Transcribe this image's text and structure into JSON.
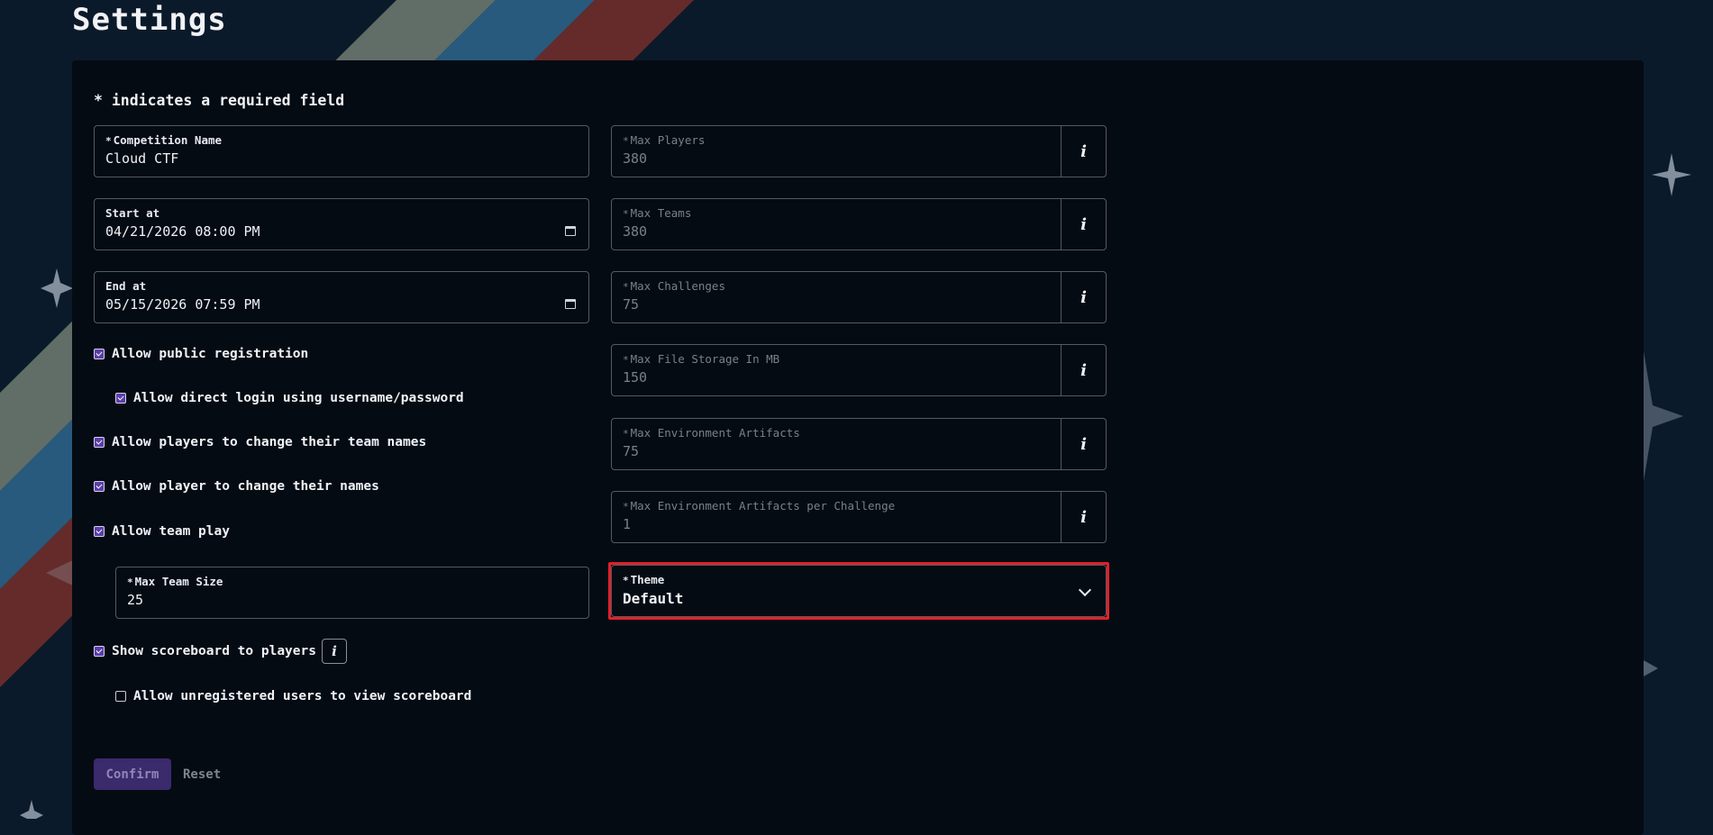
{
  "page": {
    "title": "Settings"
  },
  "form": {
    "required_note": "* indicates a required field",
    "required_marker": "*",
    "competition_name": {
      "label": "Competition Name",
      "value": "Cloud CTF",
      "required": true
    },
    "start_at": {
      "label": "Start at",
      "value": "04/21/2026 08:00 PM"
    },
    "end_at": {
      "label": "End at",
      "value": "05/15/2026 07:59 PM"
    },
    "checkboxes": {
      "public_registration": {
        "label": "Allow public registration",
        "checked": true
      },
      "direct_login": {
        "label": "Allow direct login using username/password",
        "checked": true
      },
      "change_team_names": {
        "label": "Allow players to change their team names",
        "checked": true
      },
      "change_names": {
        "label": "Allow player to change their names",
        "checked": true
      },
      "team_play": {
        "label": "Allow team play",
        "checked": true
      },
      "show_scoreboard": {
        "label": "Show scoreboard to players",
        "checked": true
      },
      "unregistered_scoreboard": {
        "label": "Allow unregistered users to view scoreboard",
        "checked": false
      }
    },
    "max_team_size": {
      "label": "Max Team Size",
      "value": "25",
      "required": true
    },
    "limits": [
      {
        "label": "Max Players",
        "value": "380",
        "required": true,
        "info": "i"
      },
      {
        "label": "Max Teams",
        "value": "380",
        "required": true,
        "info": "i"
      },
      {
        "label": "Max Challenges",
        "value": "75",
        "required": true,
        "info": "i"
      },
      {
        "label": "Max File Storage In MB",
        "value": "150",
        "required": true,
        "info": "i"
      },
      {
        "label": "Max Environment Artifacts",
        "value": "75",
        "required": true,
        "info": "i"
      },
      {
        "label": "Max Environment Artifacts per Challenge",
        "value": "1",
        "required": true,
        "info": "i"
      }
    ],
    "theme": {
      "label": "Theme",
      "value": "Default",
      "required": true,
      "focused": true
    },
    "info_glyph": "i",
    "buttons": {
      "confirm": "Confirm",
      "reset": "Reset"
    }
  },
  "colors": {
    "background": "#0b1a2a",
    "card": "#050b13",
    "accent": "#5a3fa8",
    "focus_outline": "#e0202a",
    "stripe_1": "#7f8a7c",
    "stripe_2": "#2f6a94",
    "stripe_3": "#7c2f2a"
  }
}
